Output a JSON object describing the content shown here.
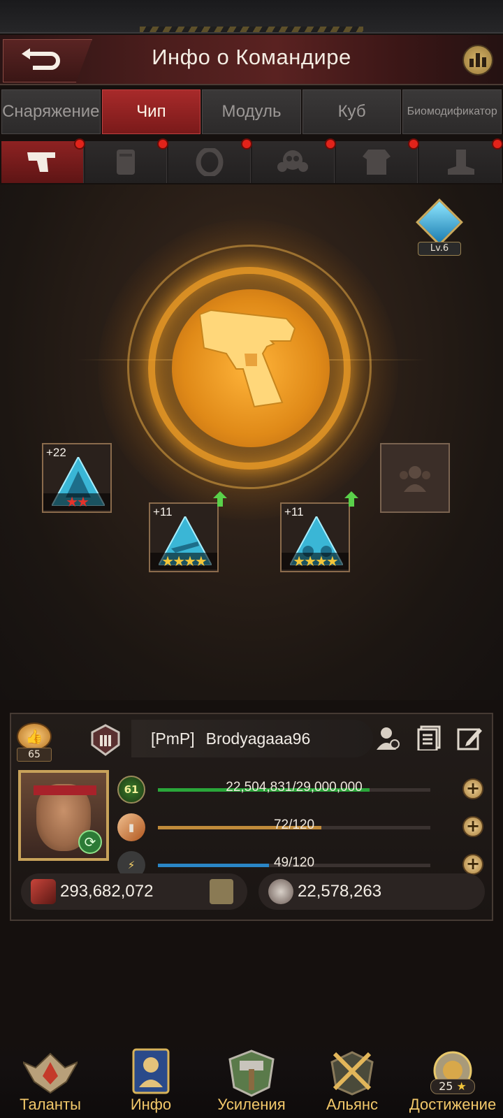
{
  "header": {
    "title": "Инфо о Командире"
  },
  "tabs": [
    {
      "label": "Снаряжение",
      "active": false
    },
    {
      "label": "Чип",
      "active": true
    },
    {
      "label": "Модуль",
      "active": false
    },
    {
      "label": "Куб",
      "active": false
    },
    {
      "label": "Биомодификатор",
      "active": false
    }
  ],
  "slots": [
    {
      "icon": "pistol-icon",
      "active": true,
      "alert": true
    },
    {
      "icon": "vest-icon",
      "active": false,
      "alert": true
    },
    {
      "icon": "ring-icon",
      "active": false,
      "alert": true
    },
    {
      "icon": "gas-mask-icon",
      "active": false,
      "alert": true
    },
    {
      "icon": "armor-icon",
      "active": false,
      "alert": true
    },
    {
      "icon": "boot-icon",
      "active": false,
      "alert": true
    }
  ],
  "equip_level": {
    "label": "Lv.6"
  },
  "chips": [
    {
      "level": "+22",
      "stars": 2,
      "star_color": "red",
      "upgrade": false
    },
    {
      "level": "+11",
      "stars": 4,
      "star_color": "gold",
      "upgrade": true
    },
    {
      "level": "+11",
      "stars": 4,
      "star_color": "gold",
      "upgrade": true
    }
  ],
  "player": {
    "rank": "65",
    "clan_tag": "[PmP]",
    "name": "Brodyagaaa96",
    "level": "61",
    "exp": {
      "text": "22,504,831/29,000,000",
      "fraction": 0.776
    },
    "ammo": {
      "text": "72/120",
      "fraction": 0.6
    },
    "energy": {
      "text": "49/120",
      "fraction": 0.408
    },
    "power": "293,682,072",
    "kills": "22,578,263"
  },
  "nav": [
    {
      "label": "Таланты"
    },
    {
      "label": "Инфо"
    },
    {
      "label": "Усиления"
    },
    {
      "label": "Альянс"
    },
    {
      "label": "Достижение",
      "count": "25",
      "star": "★"
    }
  ],
  "colors": {
    "accent_red": "#a82a2a",
    "exp_bar": "#2aa63a",
    "ammo_bar": "#c08a3a",
    "energy_bar": "#2a86c6",
    "alert_dot": "#e2231a",
    "nav_label": "#f2c86a"
  }
}
